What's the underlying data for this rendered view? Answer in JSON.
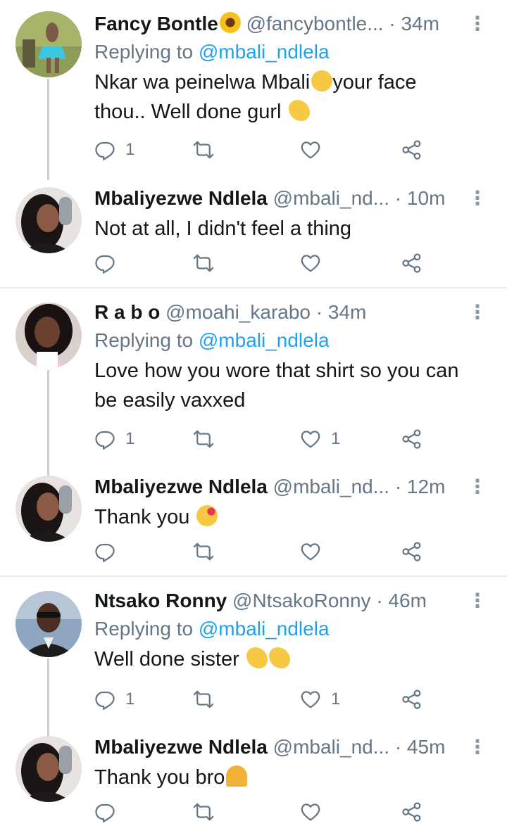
{
  "threads": [
    {
      "reply": {
        "name": "Fancy Bontle",
        "handle": "@fancybontle...",
        "time": "· 34m",
        "replying_label": "Replying to",
        "replying_to": "@mbali_ndlela",
        "text_line1": "Nkar wa peinelwa Mbali",
        "text_line1b": "your face",
        "text_line2": "thou.. Well done gurl",
        "reply_count": "1",
        "like_count": ""
      },
      "response": {
        "name": "Mbaliyezwe Ndlela",
        "handle": "@mbali_nd...",
        "time": "· 10m",
        "text": "Not at all, I didn't feel a thing"
      }
    },
    {
      "reply": {
        "name": "R a b o",
        "handle": "@moahi_karabo",
        "time": "· 34m",
        "replying_label": "Replying to",
        "replying_to": "@mbali_ndlela",
        "text_line1": "Love how you wore that shirt so you can",
        "text_line2": "be easily vaxxed",
        "reply_count": "1",
        "like_count": "1"
      },
      "response": {
        "name": "Mbaliyezwe Ndlela",
        "handle": "@mbali_nd...",
        "time": "· 12m",
        "text": "Thank you"
      }
    },
    {
      "reply": {
        "name": "Ntsako Ronny",
        "handle": "@NtsakoRonny",
        "time": "· 46m",
        "replying_label": "Replying to",
        "replying_to": "@mbali_ndlela",
        "text_line1": "Well done sister",
        "reply_count": "1",
        "like_count": "1"
      },
      "response": {
        "name": "Mbaliyezwe Ndlela",
        "handle": "@mbali_nd...",
        "time": "· 45m",
        "text": "Thank you bro"
      }
    }
  ],
  "more_glyph": "⋮",
  "colors": {
    "link": "#1da1f2",
    "muted": "#657786",
    "text": "#14171a",
    "line": "#c8d1d9"
  }
}
